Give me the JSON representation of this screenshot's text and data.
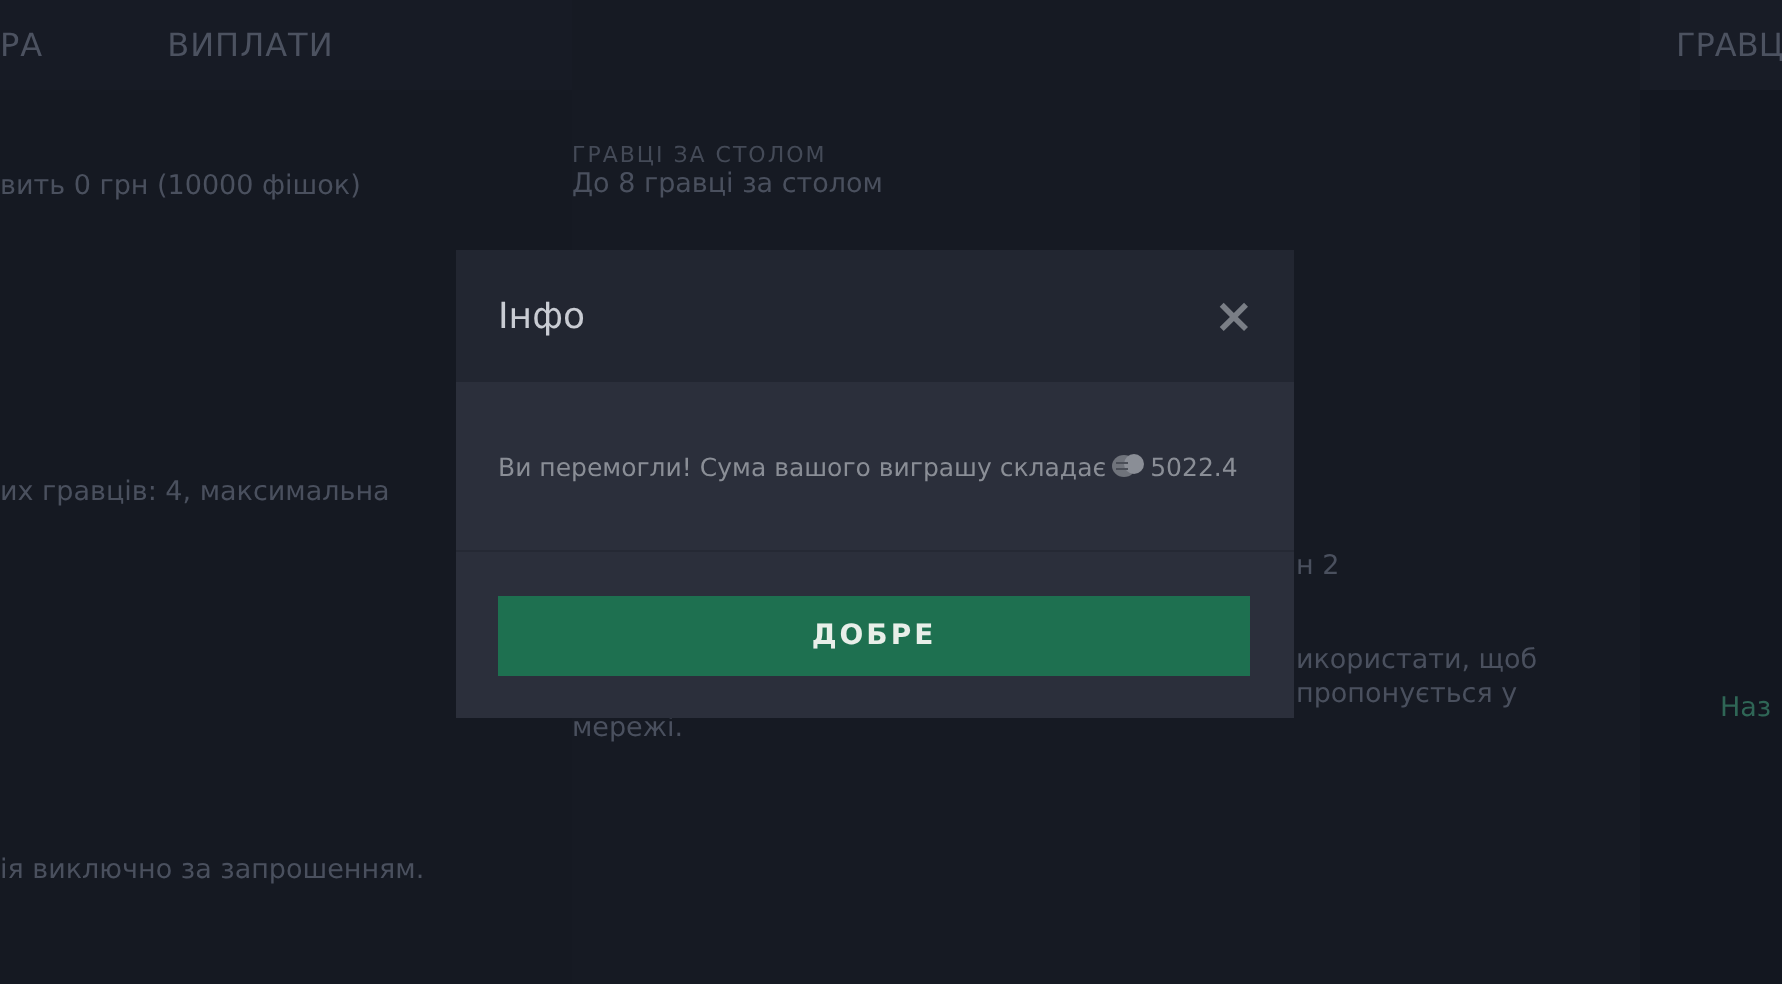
{
  "tabs": [
    {
      "label": "РА"
    },
    {
      "label": "ВИПЛАТИ"
    }
  ],
  "left_texts": [
    {
      "text": "вить 0 грн (10000 фішок)"
    },
    {
      "text": "их гравців: 4, максимальна"
    },
    {
      "text": "ія виключно за запрошенням."
    }
  ],
  "middle": {
    "label": "ГРАВЦІ ЗА СТОЛОМ",
    "value": "До 8 гравці за столом",
    "fragments": [
      "н 2",
      "икористати, щоб",
      "пропонується у"
    ],
    "last_line": "мережі."
  },
  "right_panel": {
    "header": "ГРАВЦ",
    "text": "Наз"
  },
  "dialog": {
    "title": "Інфо",
    "close": "×",
    "message": "Ви перемогли! Сума вашого виграшу складає",
    "amount": "5022.4",
    "button": "ДОБРЕ"
  }
}
